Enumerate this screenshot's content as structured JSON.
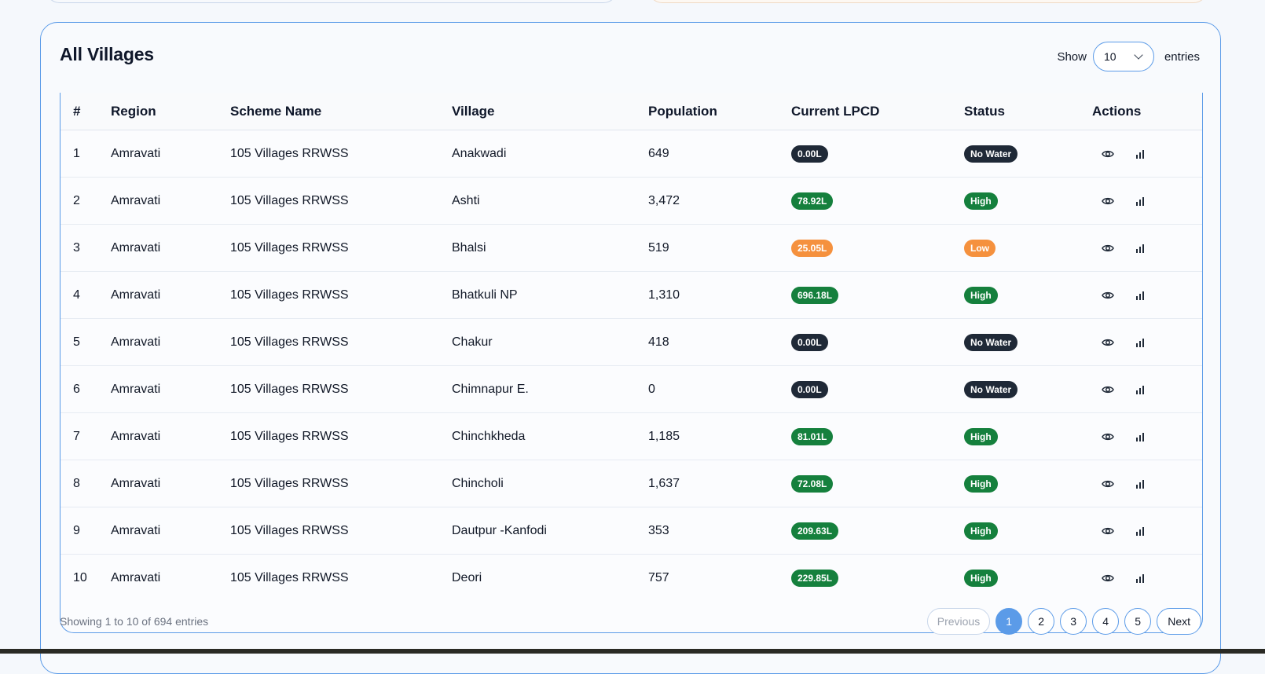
{
  "title": "All Villages",
  "length_control": {
    "show_label": "Show",
    "value": "10",
    "entries_label": "entries"
  },
  "columns": [
    "#",
    "Region",
    "Scheme Name",
    "Village",
    "Population",
    "Current LPCD",
    "Status",
    "Actions"
  ],
  "rows": [
    {
      "n": "1",
      "region": "Amravati",
      "scheme": "105 Villages RRWSS",
      "village": "Anakwadi",
      "population": "649",
      "lpcd": "0.00L",
      "lpcd_color": "#1f2937",
      "status": "No Water",
      "status_color": "#1f2937"
    },
    {
      "n": "2",
      "region": "Amravati",
      "scheme": "105 Villages RRWSS",
      "village": "Ashti",
      "population": "3,472",
      "lpcd": "78.92L",
      "lpcd_color": "#15803d",
      "status": "High",
      "status_color": "#15803d"
    },
    {
      "n": "3",
      "region": "Amravati",
      "scheme": "105 Villages RRWSS",
      "village": "Bhalsi",
      "population": "519",
      "lpcd": "25.05L",
      "lpcd_color": "#f5913e",
      "status": "Low",
      "status_color": "#f5913e"
    },
    {
      "n": "4",
      "region": "Amravati",
      "scheme": "105 Villages RRWSS",
      "village": "Bhatkuli NP",
      "population": "1,310",
      "lpcd": "696.18L",
      "lpcd_color": "#15803d",
      "status": "High",
      "status_color": "#15803d"
    },
    {
      "n": "5",
      "region": "Amravati",
      "scheme": "105 Villages RRWSS",
      "village": "Chakur",
      "population": "418",
      "lpcd": "0.00L",
      "lpcd_color": "#1f2937",
      "status": "No Water",
      "status_color": "#1f2937"
    },
    {
      "n": "6",
      "region": "Amravati",
      "scheme": "105 Villages RRWSS",
      "village": "Chimnapur E.",
      "population": "0",
      "lpcd": "0.00L",
      "lpcd_color": "#1f2937",
      "status": "No Water",
      "status_color": "#1f2937"
    },
    {
      "n": "7",
      "region": "Amravati",
      "scheme": "105 Villages RRWSS",
      "village": "Chinchkheda",
      "population": "1,185",
      "lpcd": "81.01L",
      "lpcd_color": "#15803d",
      "status": "High",
      "status_color": "#15803d"
    },
    {
      "n": "8",
      "region": "Amravati",
      "scheme": "105 Villages RRWSS",
      "village": "Chincholi",
      "population": "1,637",
      "lpcd": "72.08L",
      "lpcd_color": "#15803d",
      "status": "High",
      "status_color": "#15803d"
    },
    {
      "n": "9",
      "region": "Amravati",
      "scheme": "105 Villages RRWSS",
      "village": "Dautpur -Kanfodi",
      "population": "353",
      "lpcd": "209.63L",
      "lpcd_color": "#15803d",
      "status": "High",
      "status_color": "#15803d"
    },
    {
      "n": "10",
      "region": "Amravati",
      "scheme": "105 Villages RRWSS",
      "village": "Deori",
      "population": "757",
      "lpcd": "229.85L",
      "lpcd_color": "#15803d",
      "status": "High",
      "status_color": "#15803d"
    }
  ],
  "row_actions": [
    "eye-icon",
    "bar-chart-icon"
  ],
  "footer": {
    "info": "Showing 1 to 10 of 694 entries"
  },
  "pagination": {
    "previous": "Previous",
    "pages": [
      "1",
      "2",
      "3",
      "4",
      "5"
    ],
    "current": "1",
    "next": "Next"
  },
  "colors": {
    "accent": "#5b9be8",
    "high": "#15803d",
    "low": "#f5913e",
    "no_water": "#1f2937"
  }
}
